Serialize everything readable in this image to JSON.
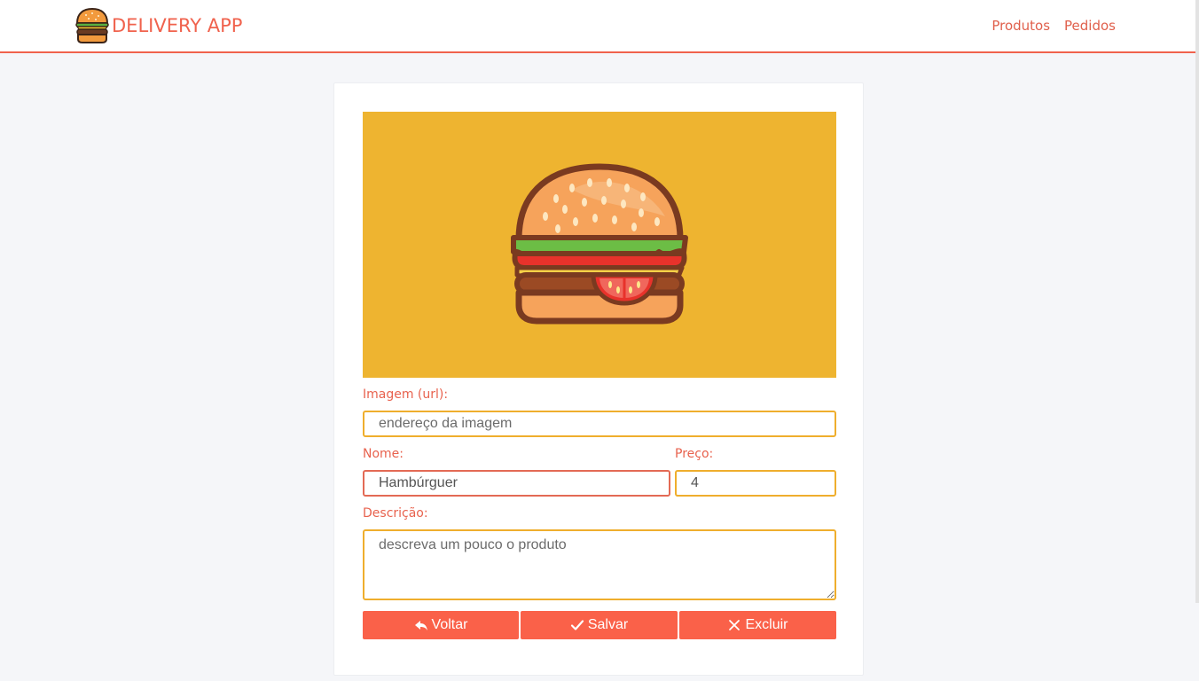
{
  "navbar": {
    "brand": "DELIVERY APP",
    "links": [
      "Produtos",
      "Pedidos"
    ]
  },
  "colors": {
    "accent": "#f0624d",
    "button": "#fa6149",
    "input_border": "#efae2d",
    "hero_background": "#eeb430"
  },
  "form": {
    "image": {
      "icon": "burger-illustration"
    },
    "image_url": {
      "label": "Imagem (url):",
      "placeholder": "endereço da imagem",
      "value": ""
    },
    "name": {
      "label": "Nome:",
      "value": "Hambúrguer"
    },
    "price": {
      "label": "Preço:",
      "value": "4"
    },
    "description": {
      "label": "Descrição:",
      "placeholder": "descreva um pouco o produto",
      "value": ""
    }
  },
  "buttons": {
    "back": {
      "label": "Voltar",
      "icon": "reply-icon"
    },
    "save": {
      "label": "Salvar",
      "icon": "check-icon"
    },
    "delete": {
      "label": "Excluir",
      "icon": "close-icon"
    }
  }
}
